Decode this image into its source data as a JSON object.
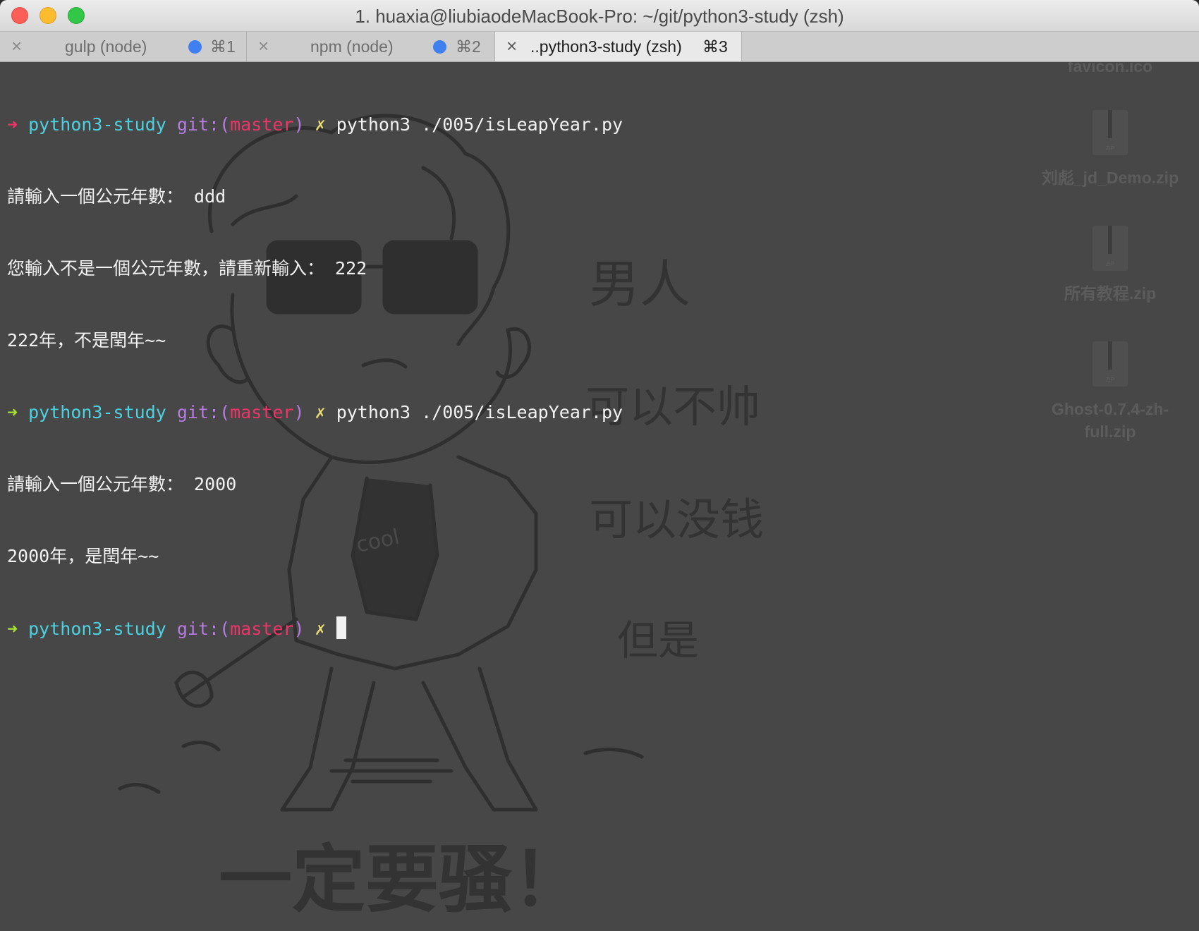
{
  "window": {
    "title": "1. huaxia@liubiaodeMacBook-Pro: ~/git/python3-study (zsh)"
  },
  "tabs": [
    {
      "label": "gulp (node)",
      "shortcut": "⌘1",
      "active": false,
      "activity": true
    },
    {
      "label": "npm (node)",
      "shortcut": "⌘2",
      "active": false,
      "activity": true
    },
    {
      "label": "..python3-study (zsh)",
      "shortcut": "⌘3",
      "active": true,
      "activity": false
    }
  ],
  "prompt": {
    "arrow": "➜",
    "dir": "python3-study",
    "git_prefix": "git:(",
    "branch": "master",
    "git_suffix": ")",
    "dirty": "✗"
  },
  "terminal": {
    "line1_cmd": "python3 ./005/isLeapYear.py",
    "line2": "請輸入一個公元年數： ddd",
    "line3": "您輸入不是一個公元年數，請重新輸入： 222",
    "line4": "222年，不是閏年~~",
    "line5_cmd": "python3 ./005/isLeapYear.py",
    "line6": "請輸入一個公元年數： 2000",
    "line7": "2000年，是閏年~~"
  },
  "desktop": {
    "items": [
      {
        "label": "favicon.ico",
        "icon": "ico-file-icon"
      },
      {
        "label": "刘彪_jd_Demo.zip",
        "icon": "zip-file-icon"
      },
      {
        "label": "所有教程.zip",
        "icon": "zip-file-icon"
      },
      {
        "label": "Ghost-0.7.4-zh-full.zip",
        "icon": "zip-file-icon"
      }
    ],
    "zip_badge": "ZIP"
  },
  "wallpaper": {
    "texts": [
      "男人",
      "可以不帅",
      "可以没钱",
      "但是",
      "一定要骚！",
      "cool"
    ]
  },
  "colors": {
    "terminal_bg": "#474747",
    "text": "#f2f2f2",
    "arrow_error": "#f0336b",
    "arrow_ok": "#a6e22e",
    "dir": "#4cd1e0",
    "git": "#b67ae0",
    "branch": "#f0336b",
    "dirty": "#e6db74",
    "tab_activity_dot": "#3f7ff0"
  }
}
